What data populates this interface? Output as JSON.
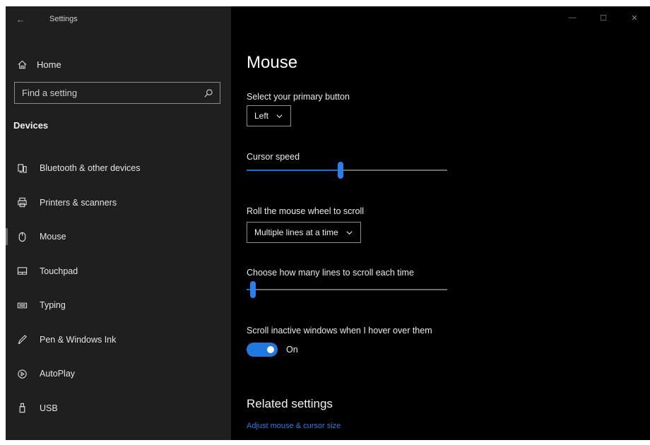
{
  "window": {
    "app_title": "Settings",
    "controls": {
      "minimize": "—",
      "maximize": "☐",
      "close": "✕"
    }
  },
  "sidebar": {
    "home_label": "Home",
    "search_placeholder": "Find a setting",
    "section_heading": "Devices",
    "items": [
      {
        "label": "Bluetooth & other devices",
        "icon": "bluetooth-devices-icon",
        "selected": false
      },
      {
        "label": "Printers & scanners",
        "icon": "printer-icon",
        "selected": false
      },
      {
        "label": "Mouse",
        "icon": "mouse-icon",
        "selected": true
      },
      {
        "label": "Touchpad",
        "icon": "touchpad-icon",
        "selected": false
      },
      {
        "label": "Typing",
        "icon": "keyboard-icon",
        "selected": false
      },
      {
        "label": "Pen & Windows Ink",
        "icon": "pen-icon",
        "selected": false
      },
      {
        "label": "AutoPlay",
        "icon": "autoplay-icon",
        "selected": false
      },
      {
        "label": "USB",
        "icon": "usb-icon",
        "selected": false
      }
    ]
  },
  "main": {
    "title": "Mouse",
    "primary_button": {
      "label": "Select your primary button",
      "value": "Left"
    },
    "cursor_speed": {
      "label": "Cursor speed",
      "level": 0.47
    },
    "wheel_scroll": {
      "label": "Roll the mouse wheel to scroll",
      "value": "Multiple lines at a time"
    },
    "lines_to_scroll": {
      "label": "Choose how many lines to scroll each time",
      "level": 0.03
    },
    "scroll_inactive": {
      "label": "Scroll inactive windows when I hover over them",
      "state": "On"
    },
    "related": {
      "heading": "Related settings",
      "link": "Adjust mouse & cursor size"
    }
  },
  "colors": {
    "accent": "#1f79e0",
    "sidebar_bg": "#1f1f1f",
    "content_bg": "#000000"
  }
}
